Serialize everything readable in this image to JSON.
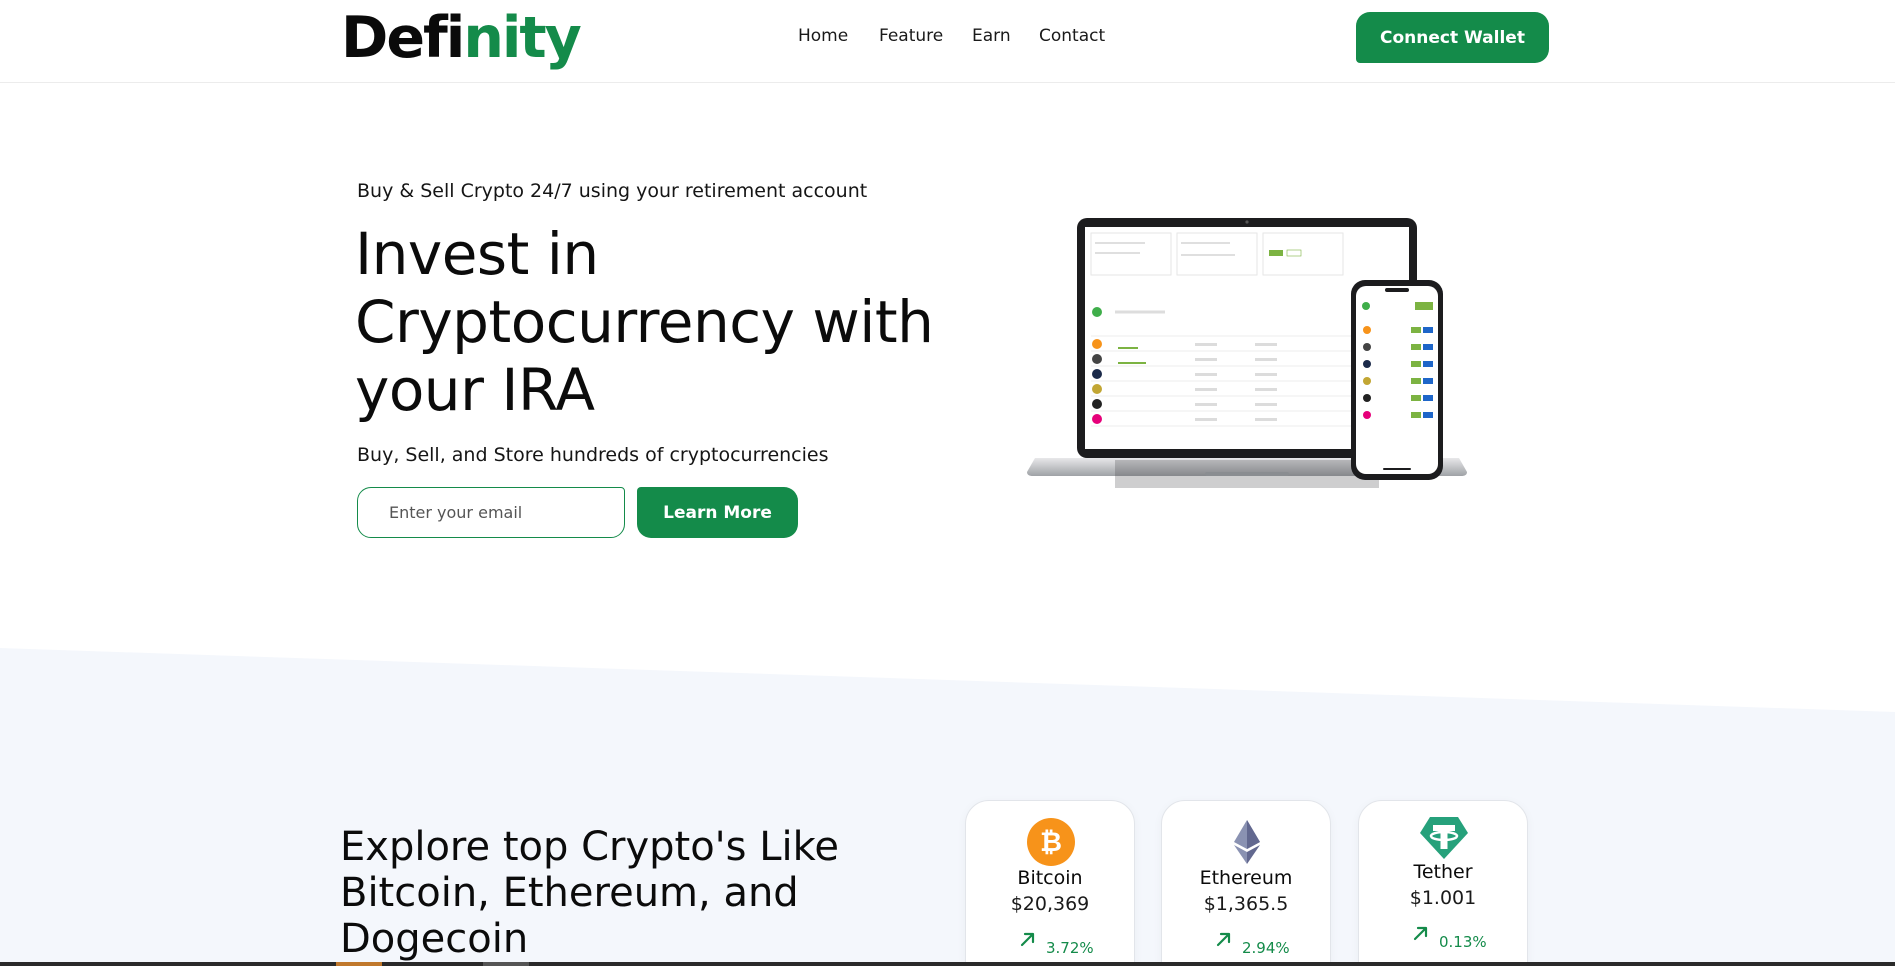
{
  "header": {
    "logo_main": "Defi",
    "logo_accent": "nity",
    "nav": [
      "Home",
      "Feature",
      "Earn",
      "Contact"
    ],
    "connect_label": "Connect Wallet"
  },
  "hero": {
    "tagline": "Buy & Sell Crypto 24/7 using your retirement account",
    "title": "Invest in Cryptocurrency with your IRA",
    "subtitle": "Buy, Sell, and Store hundreds of cryptocurrencies",
    "email_placeholder": "Enter your email",
    "cta_label": "Learn More",
    "image_icon": "laptop-and-phone-dashboard-mockup"
  },
  "explore": {
    "title": "Explore top Crypto's Like Bitcoin, Ethereum, and Dogecoin",
    "coins": [
      {
        "name": "Bitcoin",
        "price": "$20,369",
        "change": "3.72%",
        "icon": "bitcoin-icon"
      },
      {
        "name": "Ethereum",
        "price": "$1,365.5",
        "change": "2.94%",
        "icon": "ethereum-icon"
      },
      {
        "name": "Tether",
        "price": "$1.001",
        "change": "0.13%",
        "icon": "tether-icon"
      }
    ]
  },
  "colors": {
    "brand_green": "#148b4a",
    "section_bg": "#f4f7fc",
    "bitcoin_orange": "#f7931a",
    "ethereum_purple": "#627eea",
    "tether_green": "#26a17b"
  }
}
